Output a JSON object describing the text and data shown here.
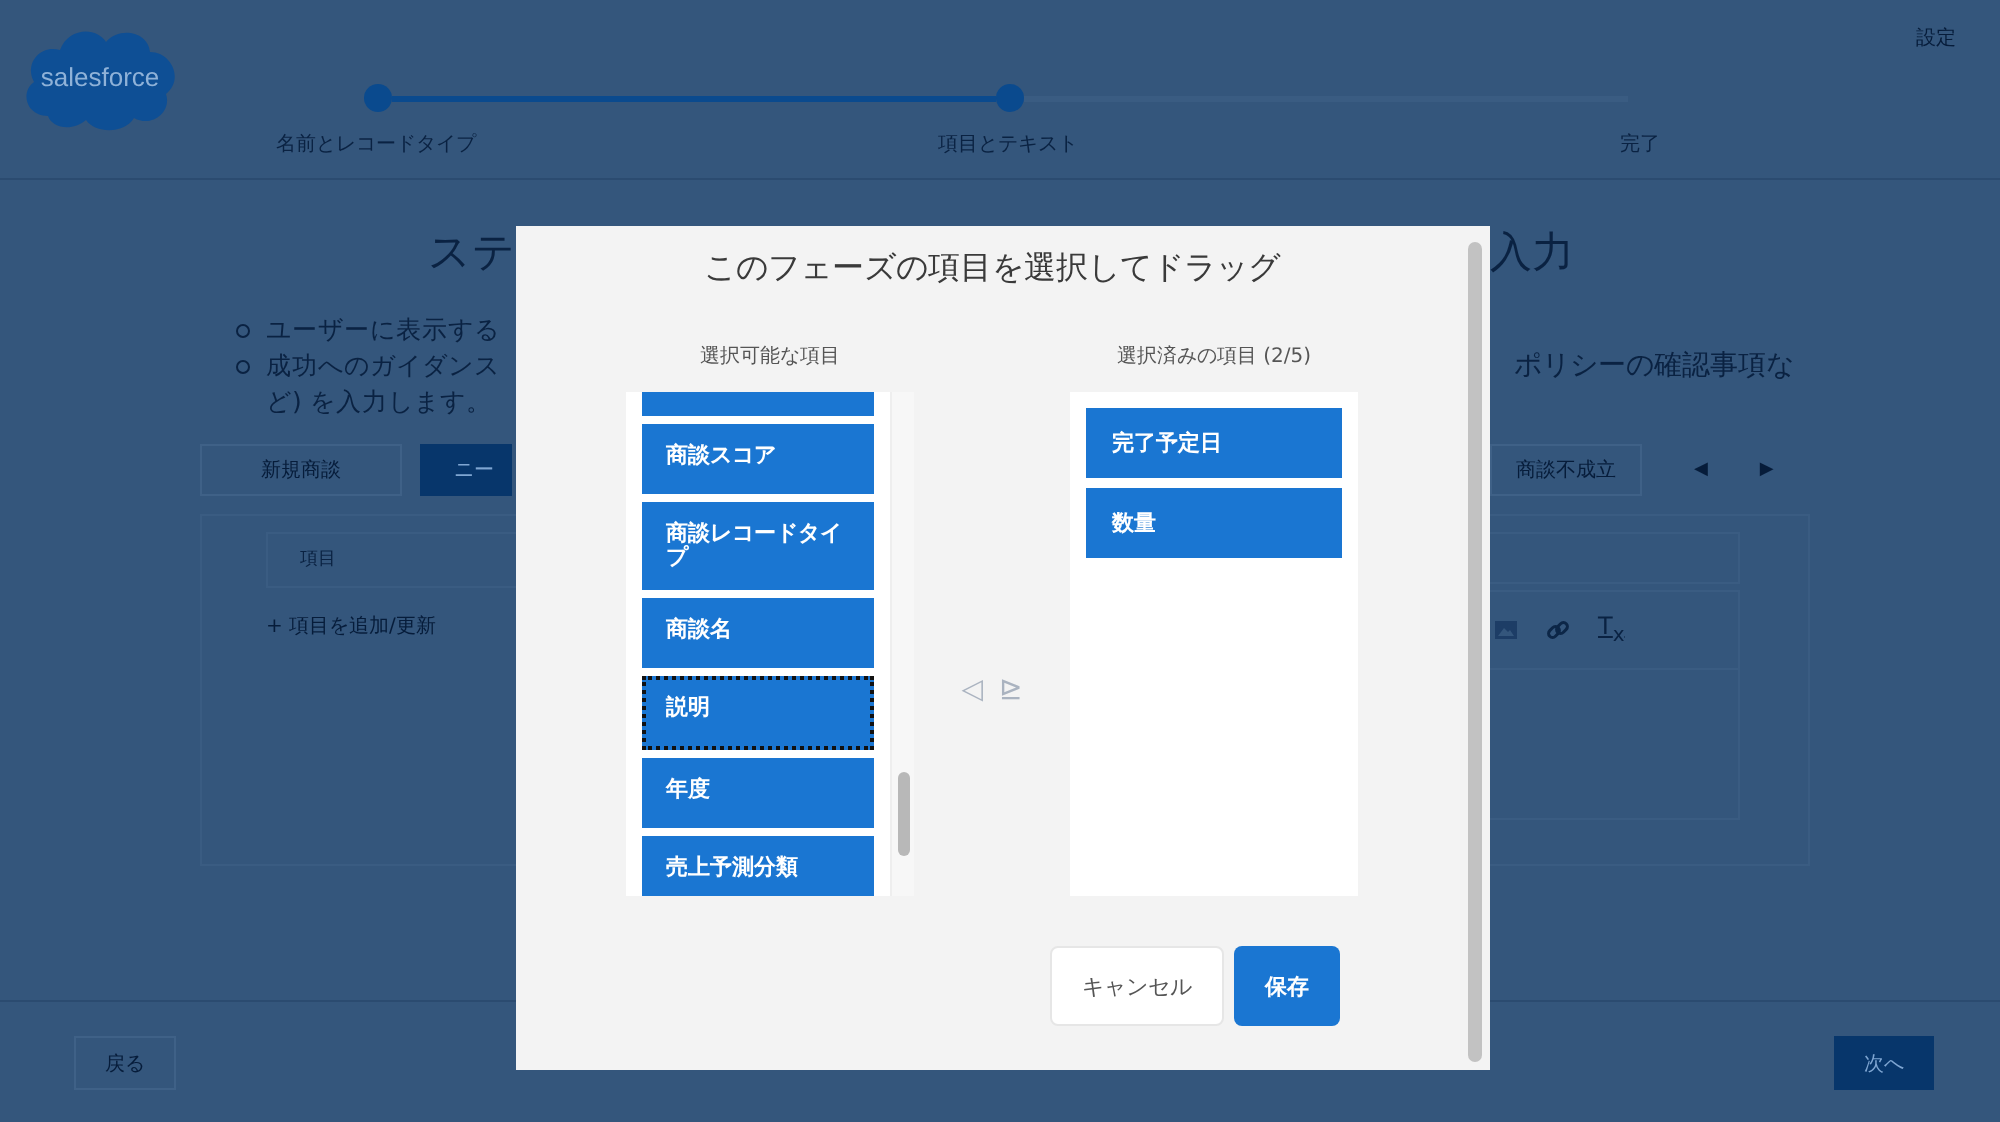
{
  "header": {
    "logo_text": "salesforce",
    "settings_link": "設定",
    "steps": [
      {
        "label": "名前とレコードタイプ",
        "reached": true
      },
      {
        "label": "項目とテキスト",
        "reached": true
      },
      {
        "label": "完了",
        "reached": false
      }
    ]
  },
  "background": {
    "title_left": "ステ",
    "title_right": "入力",
    "bullets_left": [
      "ユーザーに表示する",
      "成功へのガイダンス"
    ],
    "bullet_continuation": "ど) を入力します。",
    "bullet_right": "ポリシーの確認事項な",
    "tabs_left": [
      {
        "label": "新規商談",
        "selected": false
      },
      {
        "label": "ニー",
        "selected": true
      }
    ],
    "tabs_right": [
      {
        "label": "商談不成立",
        "selected": false
      }
    ],
    "prev_arrow": "◀",
    "next_arrow": "▶",
    "field_header": "項目",
    "add_field_link": "+ 項目を追加/更新",
    "clear_format": "T$_{x}$",
    "back_button": "戻る",
    "next_button": "次へ"
  },
  "modal": {
    "title": "このフェーズの項目を選択してドラッグ",
    "available_heading": "選択可能な項目",
    "selected_heading": "選択済みの項目 (2/5)",
    "available": [
      {
        "label": "商談スコア",
        "focused": false
      },
      {
        "label": "商談レコードタイプ",
        "focused": false
      },
      {
        "label": "商談名",
        "focused": false
      },
      {
        "label": "説明",
        "focused": true
      },
      {
        "label": "年度",
        "focused": false
      },
      {
        "label": "売上予測分類",
        "focused": false
      }
    ],
    "selected_items": [
      {
        "label": "完了予定日"
      },
      {
        "label": "数量"
      }
    ],
    "remove_arrow": "◁",
    "add_arrow": "⊵",
    "cancel_button": "キャンセル",
    "save_button": "保存"
  }
}
